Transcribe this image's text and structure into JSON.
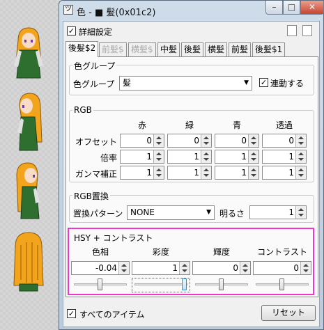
{
  "window": {
    "title": "色 - ■ 髪(0x01c2)",
    "minimize_glyph": "–",
    "maximize_glyph": "□",
    "close_glyph": "✕",
    "app_icon": "ツ"
  },
  "detail_settings": {
    "label": "詳細設定",
    "checked": true
  },
  "tabs": [
    {
      "label": "後髪$2",
      "state": "active"
    },
    {
      "label": "前髪$",
      "state": "disabled"
    },
    {
      "label": "横髪$",
      "state": "disabled"
    },
    {
      "label": "中髪",
      "state": "normal"
    },
    {
      "label": "後髪",
      "state": "normal"
    },
    {
      "label": "横髪",
      "state": "normal"
    },
    {
      "label": "前髪",
      "state": "normal"
    },
    {
      "label": "後髪$1",
      "state": "normal"
    }
  ],
  "color_group": {
    "title": "色グループ",
    "label": "色グループ",
    "value": "髪",
    "link_label": "連動する",
    "link_checked": true
  },
  "rgb": {
    "title": "RGB",
    "columns": [
      "赤",
      "緑",
      "青",
      "透過"
    ],
    "rows": [
      {
        "label": "オフセット",
        "values": [
          "0",
          "0",
          "0",
          "0"
        ]
      },
      {
        "label": "倍率",
        "values": [
          "1",
          "1",
          "1",
          "1"
        ]
      },
      {
        "label": "ガンマ補正",
        "values": [
          "1",
          "1",
          "1",
          "1"
        ]
      }
    ]
  },
  "rgb_replace": {
    "title": "RGB置換",
    "pattern_label": "置換パターン",
    "pattern_value": "NONE",
    "brightness_label": "明るさ",
    "brightness_value": "1"
  },
  "hsy": {
    "title": "HSY + コントラスト",
    "columns": [
      "色相",
      "彩度",
      "輝度",
      "コントラスト"
    ],
    "values": [
      "-0.04",
      "1",
      "0",
      "0"
    ]
  },
  "all_items": {
    "label": "すべてのアイテム",
    "checked": true
  },
  "reset_label": "リセット",
  "colors": {
    "highlight": "#f036c8",
    "hair": "#f2a51c",
    "dress": "#2e6e2e"
  }
}
